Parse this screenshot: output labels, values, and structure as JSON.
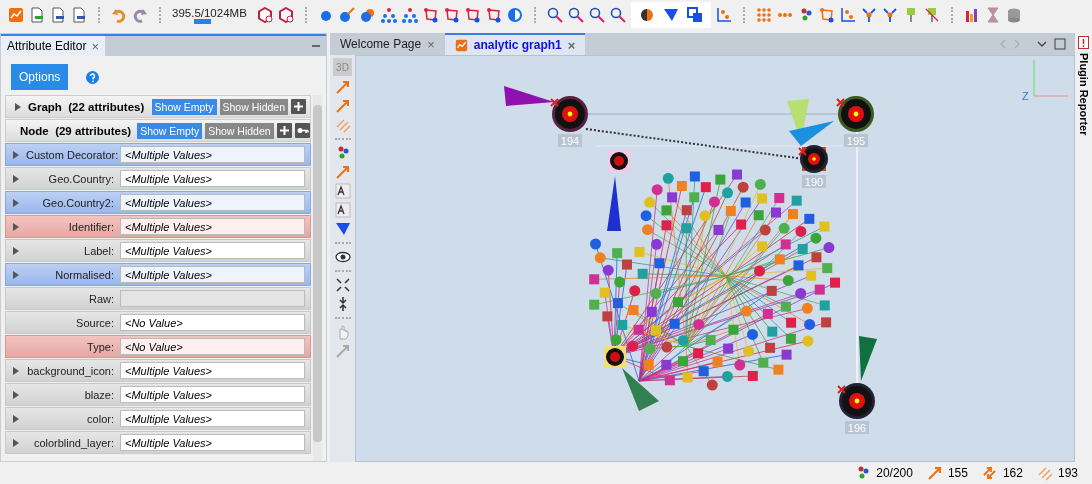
{
  "toolbar": {
    "memory": {
      "text": "395.5/1024MB",
      "level": 0.39
    }
  },
  "attribute_editor": {
    "tab": "Attribute Editor",
    "close": "×",
    "options_button": "Options",
    "sections": [
      {
        "title": "Graph  (22 attributes)",
        "expanded": false,
        "buttons": [
          {
            "label": "Show Empty",
            "on": true
          },
          {
            "label": "Show Hidden",
            "on": false
          }
        ],
        "key_button": false
      },
      {
        "title": "Node  (29 attributes)",
        "expanded": true,
        "buttons": [
          {
            "label": "Show Empty",
            "on": true
          },
          {
            "label": "Show Hidden",
            "on": false
          }
        ],
        "key_button": true,
        "attributes": [
          {
            "name": "Custom Decorator:",
            "value": "<Multiple Values>",
            "kind": "custom",
            "expandable": true,
            "disabled": false
          },
          {
            "name": "Geo.Country:",
            "value": "<Multiple Values>",
            "kind": "plain",
            "expandable": true,
            "disabled": false
          },
          {
            "name": "Geo.Country2:",
            "value": "<Multiple Values>",
            "kind": "custom",
            "expandable": true,
            "disabled": false
          },
          {
            "name": "Identifier:",
            "value": "<Multiple Values>",
            "kind": "key",
            "expandable": true,
            "disabled": false
          },
          {
            "name": "Label:",
            "value": "<Multiple Values>",
            "kind": "plain",
            "expandable": true,
            "disabled": false
          },
          {
            "name": "Normalised:",
            "value": "<Multiple Values>",
            "kind": "custom",
            "expandable": true,
            "disabled": false
          },
          {
            "name": "Raw:",
            "kind": "plain",
            "expandable": false,
            "disabled": true
          },
          {
            "name": "Source:",
            "value": "<No Value>",
            "kind": "plain",
            "expandable": false,
            "disabled": false
          },
          {
            "name": "Type:",
            "value": "<No Value>",
            "kind": "key",
            "expandable": false,
            "disabled": false
          },
          {
            "name": "background_icon:",
            "value": "<Multiple Values>",
            "kind": "plain",
            "expandable": true,
            "disabled": false
          },
          {
            "name": "blaze:",
            "value": "<Multiple Values>",
            "kind": "plain",
            "expandable": true,
            "disabled": false
          },
          {
            "name": "color:",
            "value": "<Multiple Values>",
            "kind": "plain",
            "expandable": true,
            "disabled": false
          },
          {
            "name": "colorblind_layer:",
            "value": "<Multiple Values>",
            "kind": "plain",
            "expandable": true,
            "disabled": false
          }
        ]
      }
    ]
  },
  "tabs": [
    {
      "label": "Welcome Page",
      "selected": false,
      "close": "×"
    },
    {
      "label": "analytic graph1",
      "selected": true,
      "close": "×"
    }
  ],
  "view_toolbar": {
    "mode_button": "3D"
  },
  "graph": {
    "nodes": [
      {
        "label": "194"
      },
      {
        "label": "195"
      },
      {
        "label": "190"
      },
      {
        "label": "196"
      }
    ],
    "axis_label": "Z"
  },
  "plugin_reporter": "Plugin Reporter",
  "status_bar": [
    {
      "kind": "nodes",
      "text": "20/200"
    },
    {
      "kind": "transactions",
      "text": "155"
    },
    {
      "kind": "edges",
      "text": "162"
    },
    {
      "kind": "links",
      "text": "193"
    }
  ]
}
